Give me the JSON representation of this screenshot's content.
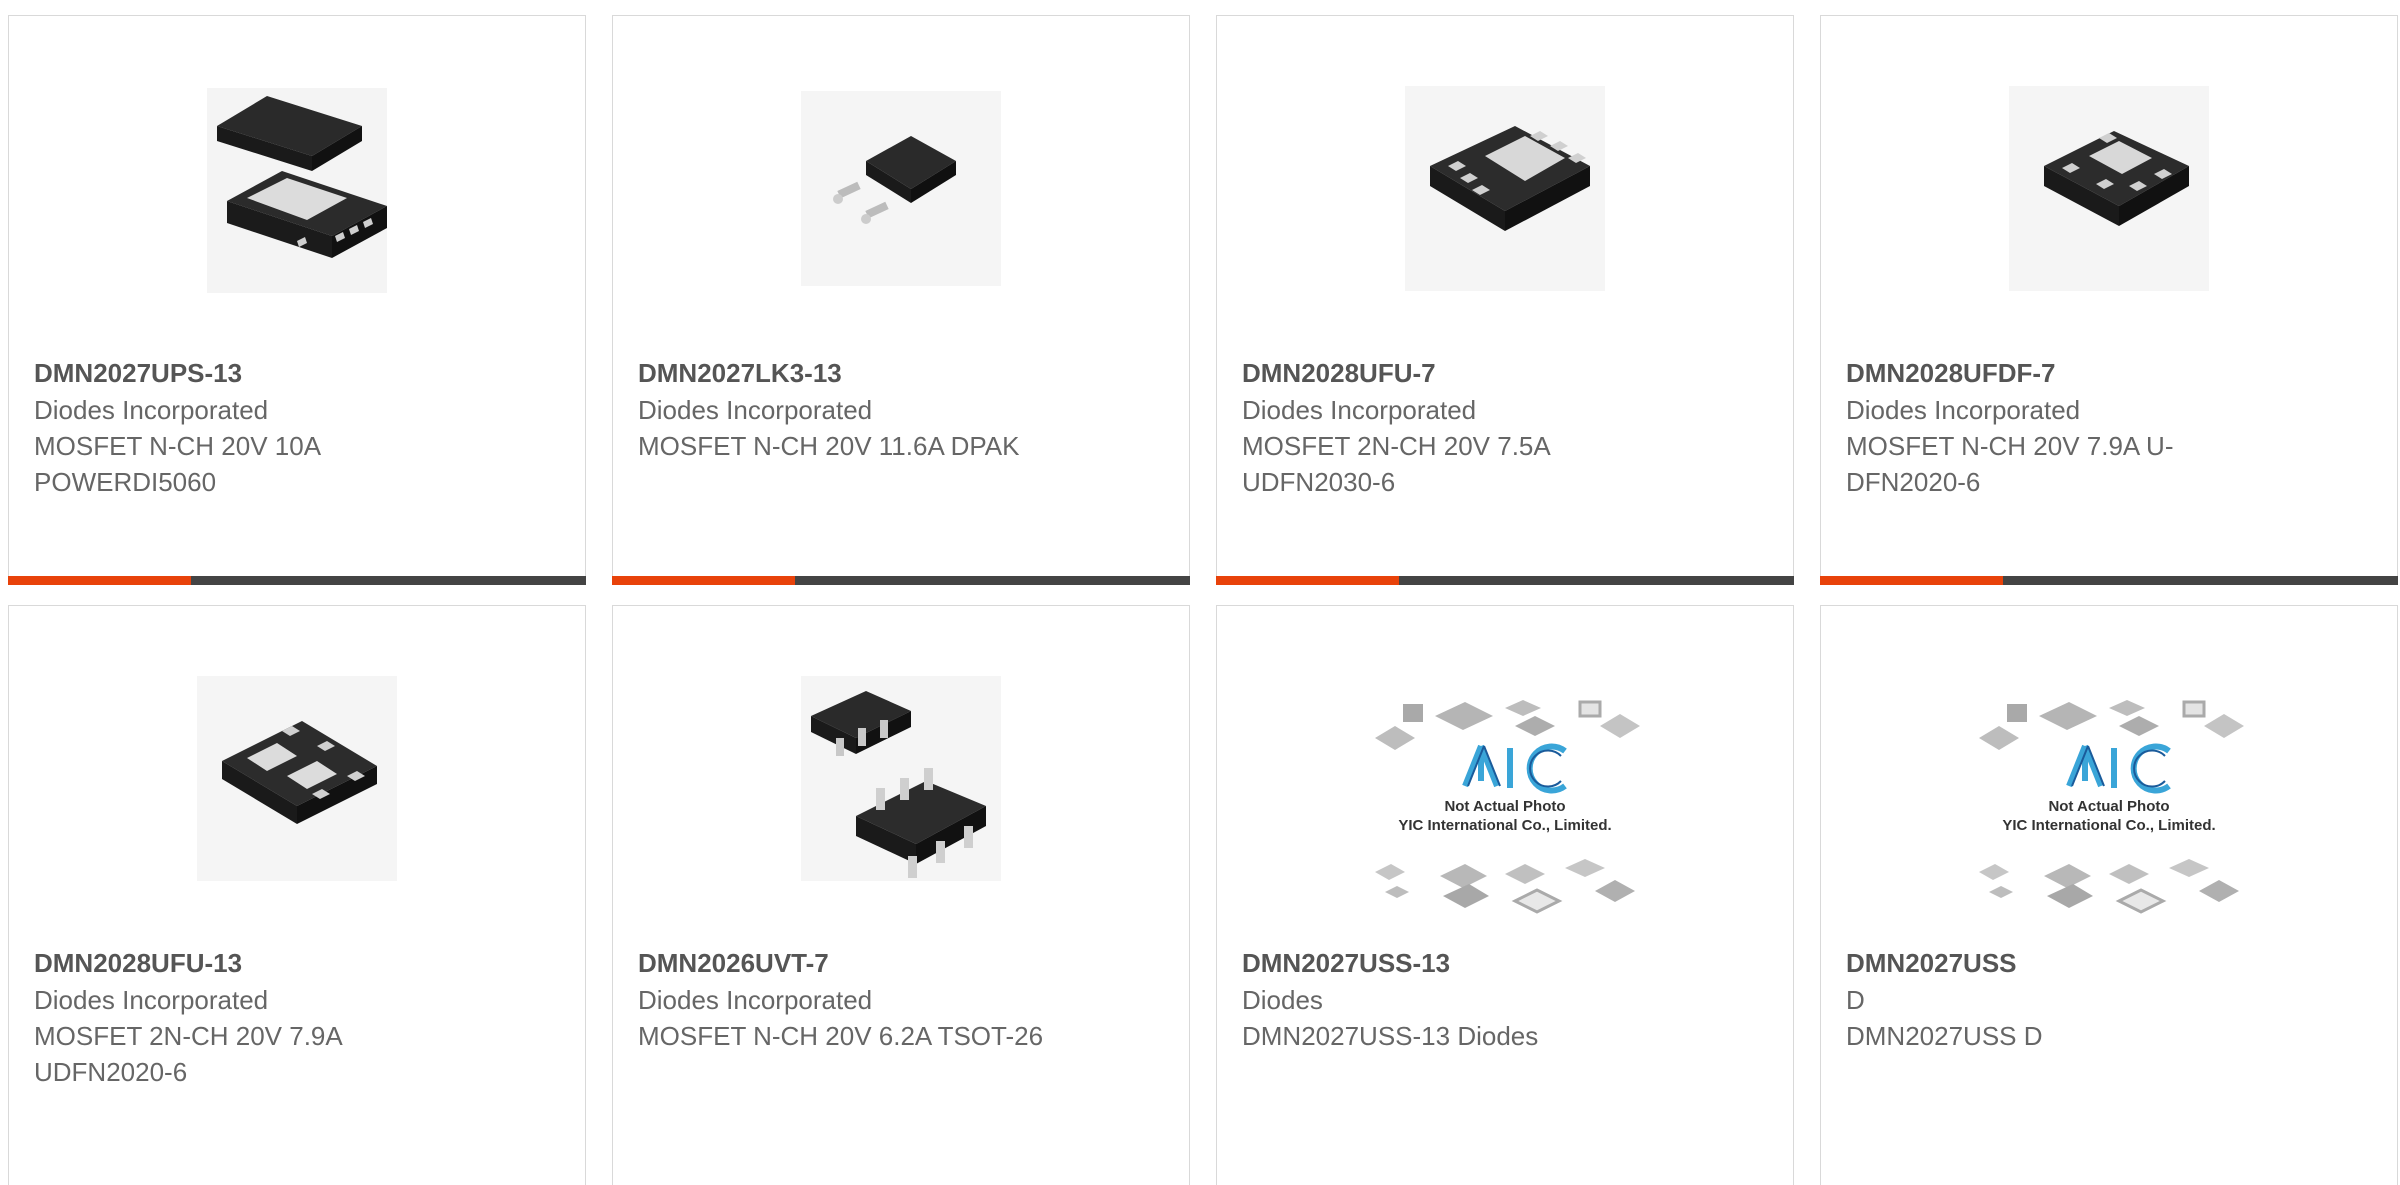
{
  "products": [
    {
      "part": "DMN2027UPS-13",
      "mfr": "Diodes Incorporated",
      "desc": "MOSFET N-CH 20V 10A POWERDI5060",
      "image_icon": "powerdi5060-package-icon"
    },
    {
      "part": "DMN2027LK3-13",
      "mfr": "Diodes Incorporated",
      "desc": "MOSFET N-CH 20V 11.6A DPAK",
      "image_icon": "dpak-package-icon"
    },
    {
      "part": "DMN2028UFU-7",
      "mfr": "Diodes Incorporated",
      "desc": "MOSFET 2N-CH 20V 7.5A UDFN2030-6",
      "image_icon": "udfn-package-icon"
    },
    {
      "part": "DMN2028UFDF-7",
      "mfr": "Diodes Incorporated",
      "desc": "MOSFET N-CH 20V 7.9A U-DFN2020-6",
      "image_icon": "udfn-package-icon"
    },
    {
      "part": "DMN2028UFU-13",
      "mfr": "Diodes Incorporated",
      "desc": "MOSFET 2N-CH 20V 7.9A UDFN2020-6",
      "image_icon": "udfn-dual-package-icon"
    },
    {
      "part": "DMN2026UVT-7",
      "mfr": "Diodes Incorporated",
      "desc": "MOSFET N-CH 20V 6.2A TSOT-26",
      "image_icon": "tsot26-package-icon"
    },
    {
      "part": "DMN2027USS-13",
      "mfr": "Diodes",
      "desc": "DMN2027USS-13 Diodes",
      "image_icon": "placeholder-photo-icon",
      "placeholder_line1": "Not Actual Photo",
      "placeholder_line2": "YIC International Co., Limited."
    },
    {
      "part": "DMN2027USS",
      "mfr": "D",
      "desc": "DMN2027USS D",
      "image_icon": "placeholder-photo-icon",
      "placeholder_line1": "Not Actual Photo",
      "placeholder_line2": "YIC International Co., Limited."
    }
  ],
  "colors": {
    "accent": "#e8420a",
    "bar": "#444444",
    "part_text": "#555555",
    "body_text": "#666666",
    "border": "#d9d9d9"
  }
}
